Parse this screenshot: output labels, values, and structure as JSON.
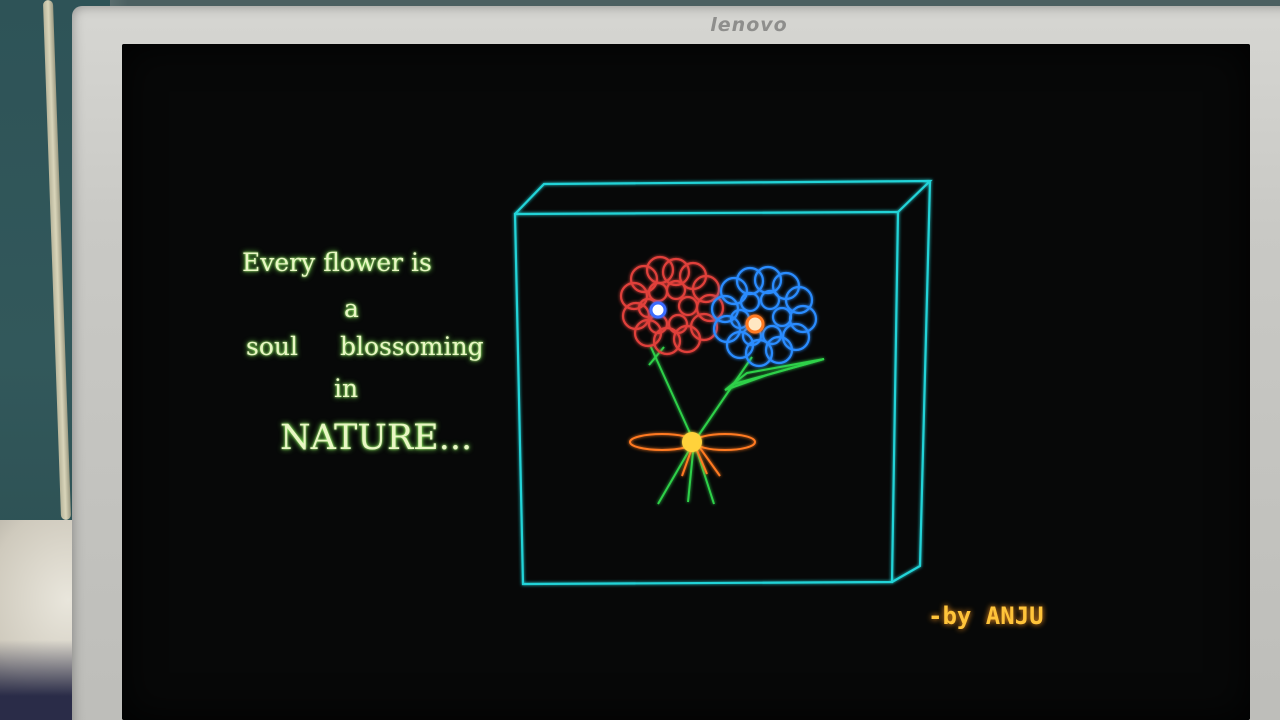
{
  "monitor": {
    "brand": "lenovo"
  },
  "screen_text": {
    "line1": "Every flower is",
    "line2": "a",
    "line3a": "soul",
    "line3b": "blossoming",
    "line4": "in",
    "line5": "NATURE...",
    "signature": "-by ANJU"
  },
  "colors": {
    "poem_text": "#e9f7c4",
    "signature": "#ffc43a",
    "box_outline": "#22d4d8",
    "red_flower": "#e0403a",
    "blue_flower": "#2a8cff",
    "stems": "#2ed14a",
    "ribbon": "#ff7a20",
    "knot": "#ffd23a",
    "screen_background": "#070808"
  },
  "icons": {
    "box": "3d-box-frame",
    "red_flower": "red-flower",
    "blue_flower": "blue-flower",
    "leaf": "leaf",
    "bow": "ribbon-bow"
  }
}
